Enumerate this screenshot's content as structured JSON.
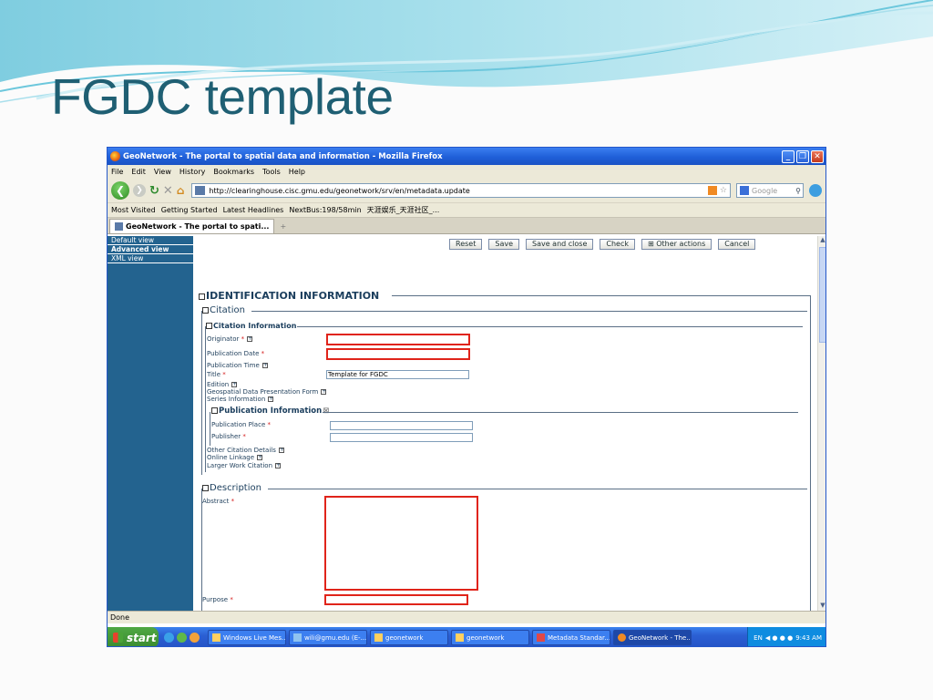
{
  "slide": {
    "title": "FGDC template"
  },
  "window": {
    "title": "GeoNetwork - The portal to spatial data and information - Mozilla Firefox"
  },
  "menu": [
    "File",
    "Edit",
    "View",
    "History",
    "Bookmarks",
    "Tools",
    "Help"
  ],
  "nav": {
    "url": "http://clearinghouse.cisc.gmu.edu/geonetwork/srv/en/metadata.update",
    "search_placeholder": "Google"
  },
  "bookmarks": [
    "Most Visited",
    "Getting Started",
    "Latest Headlines",
    "NextBus:198/58min",
    "天涯娱乐_天涯社区_..."
  ],
  "tab": {
    "label": "GeoNetwork - The portal to spati...",
    "new_tab": "+"
  },
  "sidebar": [
    {
      "label": "Default view"
    },
    {
      "label": "Advanced view"
    },
    {
      "label": "XML view"
    }
  ],
  "form": {
    "buttons": {
      "reset": "Reset",
      "save": "Save",
      "save_close": "Save and close",
      "check": "Check",
      "other": "⊞ Other actions",
      "cancel": "Cancel"
    },
    "identification": "IDENTIFICATION INFORMATION",
    "citation": "Citation",
    "citation_info": "Citation Information",
    "originator": "Originator",
    "pub_date": "Publication Date",
    "pub_time": "Publication Time",
    "title_label": "Title",
    "title_value": "Template for FGDC",
    "edition": "Edition",
    "geo_form": "Geospatial Data Presentation Form",
    "series": "Series Information",
    "publication_info": "Publication Information",
    "pub_place": "Publication Place",
    "publisher": "Publisher",
    "other_citation": "Other Citation Details",
    "online_linkage": "Online Linkage",
    "larger_work": "Larger Work Citation",
    "description": "Description",
    "abstract": "Abstract",
    "purpose": "Purpose",
    "req": "*",
    "expand": "+"
  },
  "status": "Done",
  "taskbar": {
    "start": "start",
    "tasks": [
      "Windows Live Mes...",
      "wili@gmu.edu (E-...",
      "geonetwork",
      "geonetwork",
      "Metadata Standar...",
      "GeoNetwork - The..."
    ],
    "lang": "EN",
    "time": "9:43 AM"
  }
}
